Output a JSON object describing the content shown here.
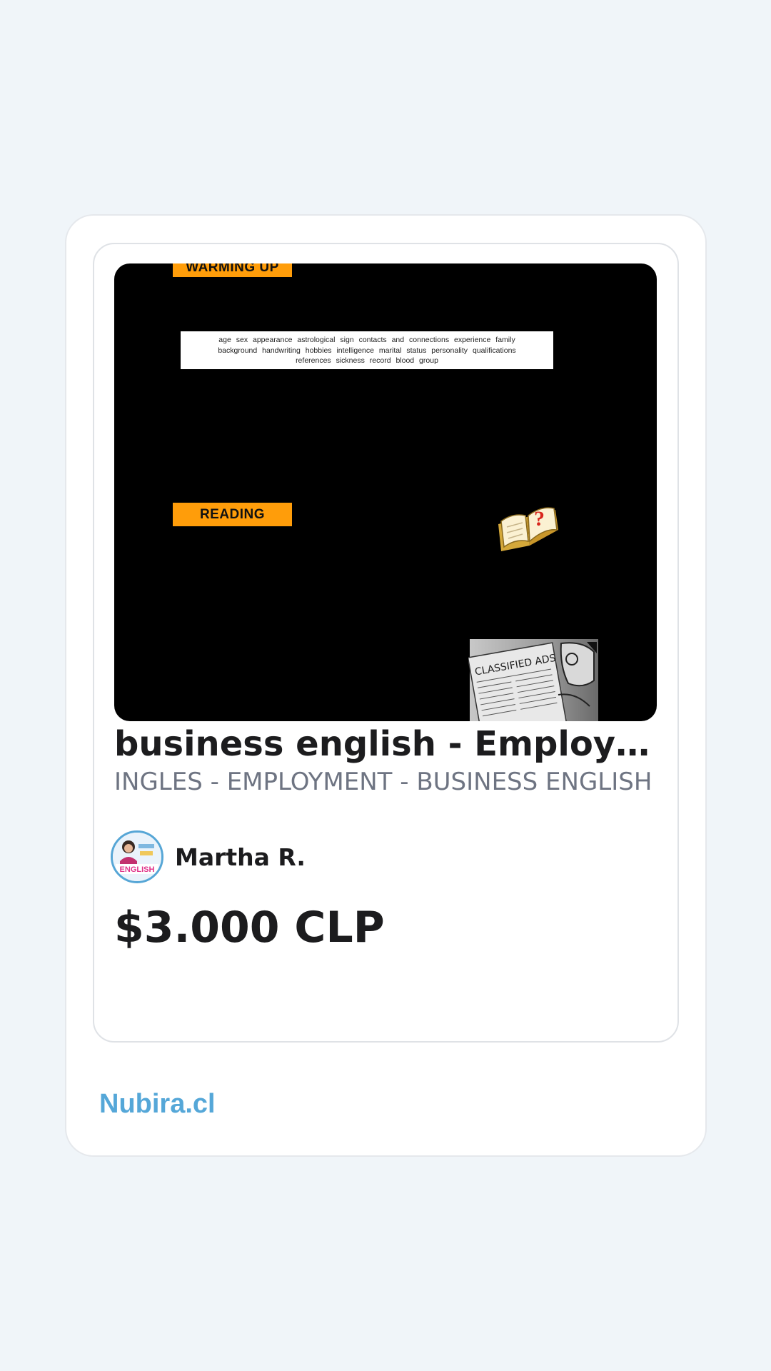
{
  "thumbnail": {
    "warming_label": "WARMING  UP",
    "vocab_lines": [
      "age    sex    appearance    astrological sign    contacts and connections    experience    family",
      "background    handwriting    hobbies    intelligence    marital status    personality    qualifications",
      "references    sickness record    blood group"
    ],
    "reading_label": "READING",
    "news_heading": "CLASSIFIED ADS"
  },
  "product": {
    "title": "business english - Employment",
    "subtitle": "INGLES - EMPLOYMENT - BUSINESS ENGLISH",
    "price": "$3.000 CLP"
  },
  "author": {
    "name": "Martha R.",
    "avatar_text": "ENGLISH"
  },
  "footer": {
    "brand": "Nubira.cl"
  },
  "colors": {
    "background": "#f0f5f9",
    "brand": "#55a7d8",
    "tag_orange": "#ff9d0a",
    "text_primary": "#1c1c1e",
    "text_secondary": "#6e7482"
  }
}
